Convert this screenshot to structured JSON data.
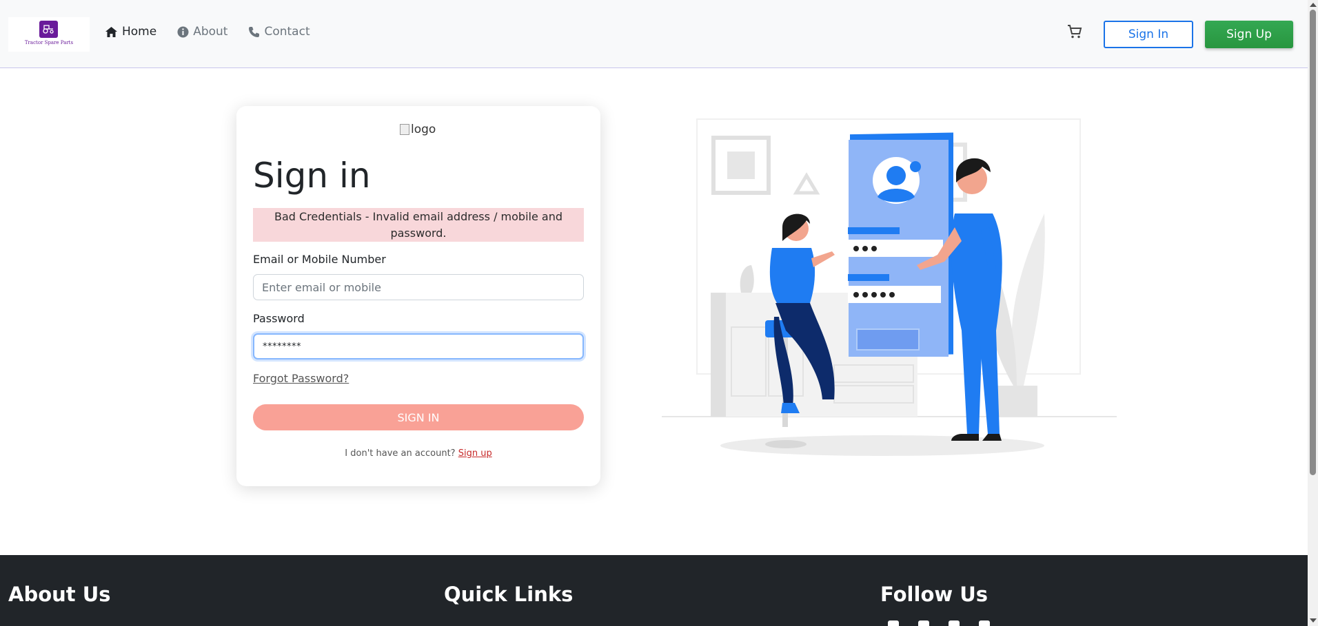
{
  "nav": {
    "brand_text": "Tractor Spare Parts",
    "links": [
      {
        "label": "Home",
        "icon": "home-icon"
      },
      {
        "label": "About",
        "icon": "info-icon"
      },
      {
        "label": "Contact",
        "icon": "phone-icon"
      }
    ],
    "cart_icon": "cart-icon",
    "signin_label": "Sign In",
    "signup_label": "Sign Up"
  },
  "card": {
    "logo_alt": "logo",
    "title": "Sign in",
    "alert": "Bad Credentials - Invalid email address / mobile and password.",
    "email_label": "Email or Mobile Number",
    "email_placeholder": "Enter email or mobile",
    "email_value": "",
    "password_label": "Password",
    "password_value": "********",
    "forgot_label": "Forgot Password?",
    "submit_label": "SIGN IN",
    "no_account_text": "I don't have an account?",
    "signup_link": "Sign up"
  },
  "footer": {
    "about_title": "About Us",
    "links_title": "Quick Links",
    "follow_title": "Follow Us"
  },
  "colors": {
    "primary": "#1a73e8",
    "success": "#28a745",
    "alert_bg": "#f8d7da",
    "submit_bg": "#f9a196",
    "footer_bg": "#212529",
    "brand_purple": "#6a1b9a",
    "illustration_blue": "#1f7cf2"
  }
}
